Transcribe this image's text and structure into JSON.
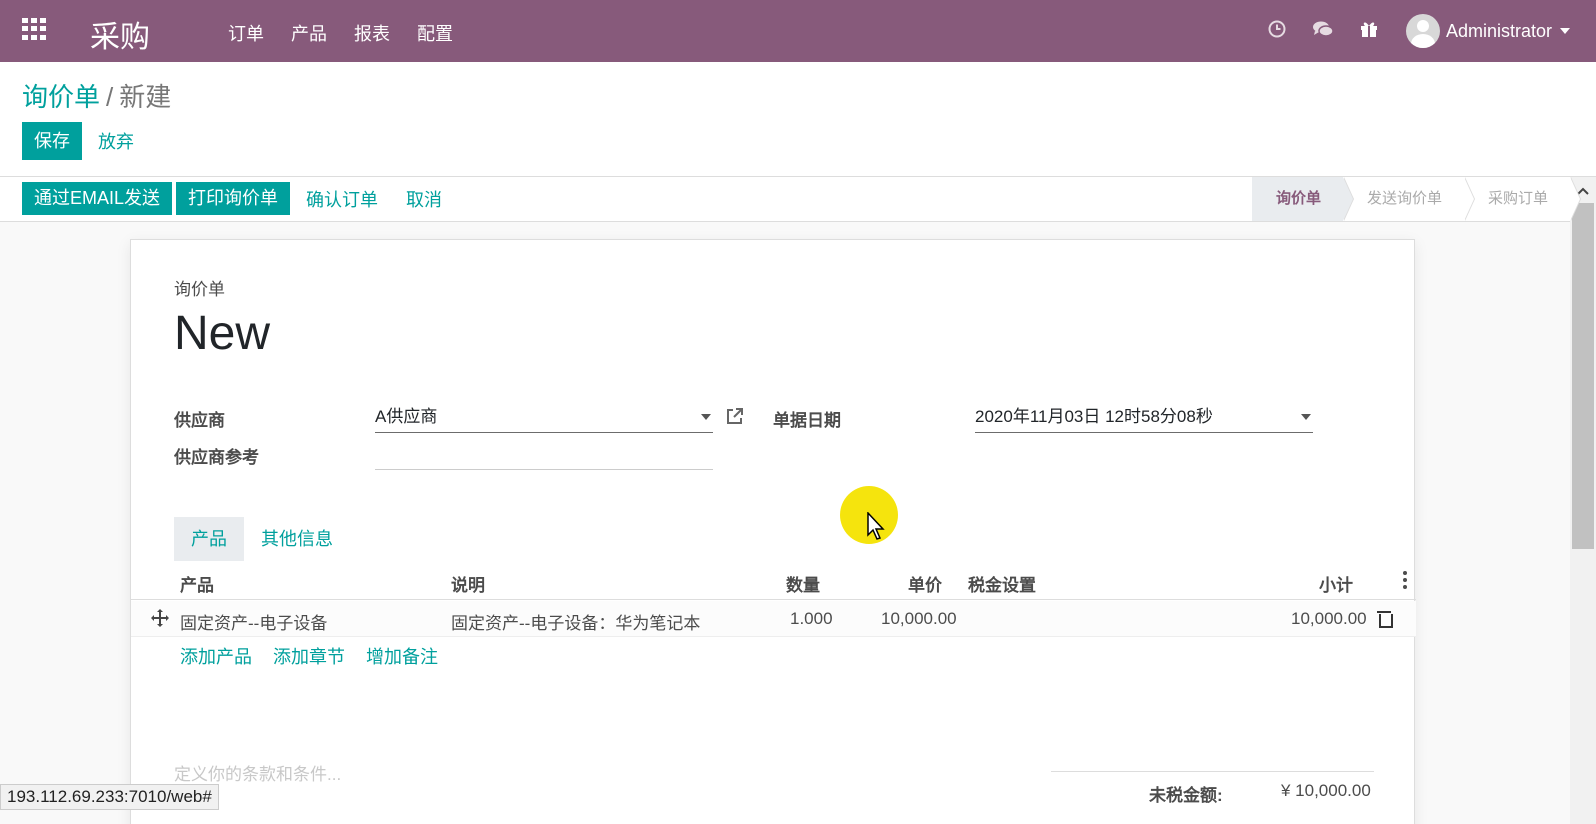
{
  "navbar": {
    "brand": "采购",
    "menu": [
      "订单",
      "产品",
      "报表",
      "配置"
    ],
    "user": "Administrator",
    "icons": [
      "clock-icon",
      "chat-icon",
      "gift-icon"
    ]
  },
  "breadcrumb": {
    "parent": "询价单",
    "separator": "/",
    "current": "新建"
  },
  "control_buttons": {
    "save": "保存",
    "discard": "放弃"
  },
  "status_buttons": {
    "send_email": "通过EMAIL发送",
    "print": "打印询价单",
    "confirm": "确认订单",
    "cancel": "取消"
  },
  "stages": [
    "询价单",
    "发送询价单",
    "采购订单"
  ],
  "form": {
    "doc_label": "询价单",
    "doc_name": "New",
    "vendor_label": "供应商",
    "vendor_value": "A供应商",
    "vendor_ref_label": "供应商参考",
    "vendor_ref_value": "",
    "date_label": "单据日期",
    "date_value": "2020年11月03日 12时58分08秒"
  },
  "tabs": [
    "产品",
    "其他信息"
  ],
  "table": {
    "headers": {
      "product": "产品",
      "description": "说明",
      "qty": "数量",
      "price": "单价",
      "taxes": "税金设置",
      "subtotal": "小计"
    },
    "rows": [
      {
        "product": "固定资产--电子设备",
        "description": "固定资产--电子设备：华为笔记本",
        "qty": "1.000",
        "price": "10,000.00",
        "taxes": "",
        "subtotal": "10,000.00"
      }
    ],
    "add_links": [
      "添加产品",
      "添加章节",
      "增加备注"
    ]
  },
  "notes_placeholder": "定义你的条款和条件...",
  "totals": {
    "untaxed_label": "未税金额:",
    "untaxed_value": "¥ 10,000.00"
  },
  "status_url": "193.112.69.233:7010/web#"
}
